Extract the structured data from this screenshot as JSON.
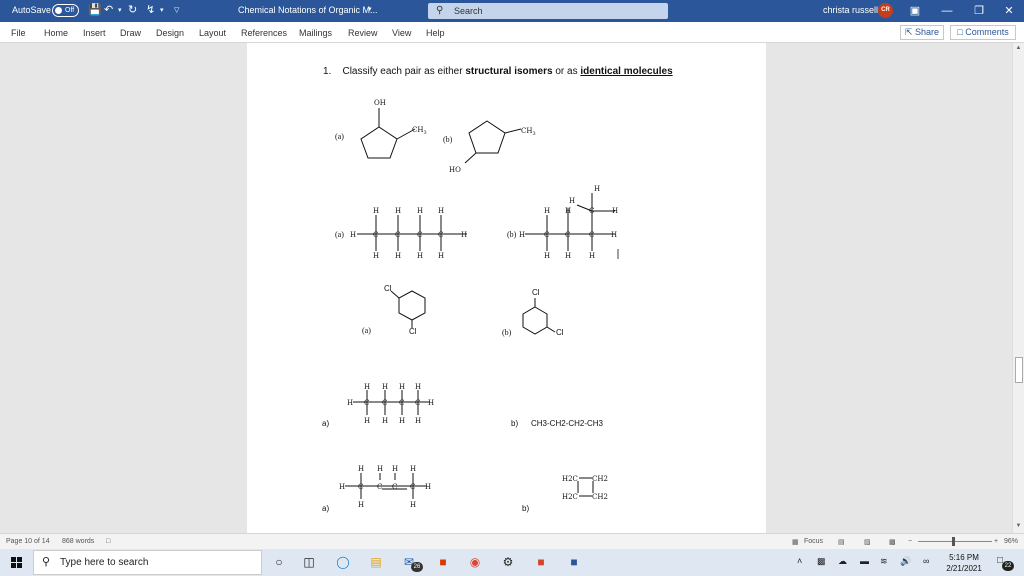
{
  "titlebar": {
    "autosave_label": "AutoSave",
    "autosave_state": "Off",
    "document_title": "Chemical Notations of Organic M...",
    "search_placeholder": "Search",
    "user_name": "christa russell",
    "user_initials": "CR"
  },
  "ribbon": {
    "tabs": [
      "File",
      "Home",
      "Insert",
      "Draw",
      "Design",
      "Layout",
      "References",
      "Mailings",
      "Review",
      "View",
      "Help"
    ],
    "share_label": "Share",
    "comments_label": "Comments"
  },
  "document": {
    "question_number": "1.",
    "question_prefix": "Classify each pair as either",
    "option_structural": "structural isomers",
    "question_middle": "or as",
    "option_identical": "identical molecules",
    "pair1": {
      "a": "(a)",
      "b": "(b)",
      "oh": "OH",
      "ch3": "CH",
      "ho": "HO",
      "sub3": "3"
    },
    "pair2": {
      "a": "(a)",
      "b": "(b)",
      "h": "H",
      "c": "C"
    },
    "pair3": {
      "a": "(a)",
      "b": "(b)",
      "cl": "Cl"
    },
    "pair4": {
      "a": "a)",
      "b": "b)",
      "condensed": "CH3-CH2-CH2-CH3"
    },
    "pair5": {
      "a": "a)",
      "b": "b)",
      "h2c": "H2C",
      "ch2": "CH2"
    }
  },
  "statusbar": {
    "page": "Page 10 of 14",
    "words": "868 words",
    "focus": "Focus",
    "zoom": "96%"
  },
  "taskbar": {
    "search_placeholder": "Type here to search",
    "mail_badge": "26",
    "time": "5:16 PM",
    "date": "2/21/2021",
    "notification_count": "22"
  },
  "colors": {
    "word_blue": "#2b579a",
    "taskbar": "#dfe8f2"
  }
}
